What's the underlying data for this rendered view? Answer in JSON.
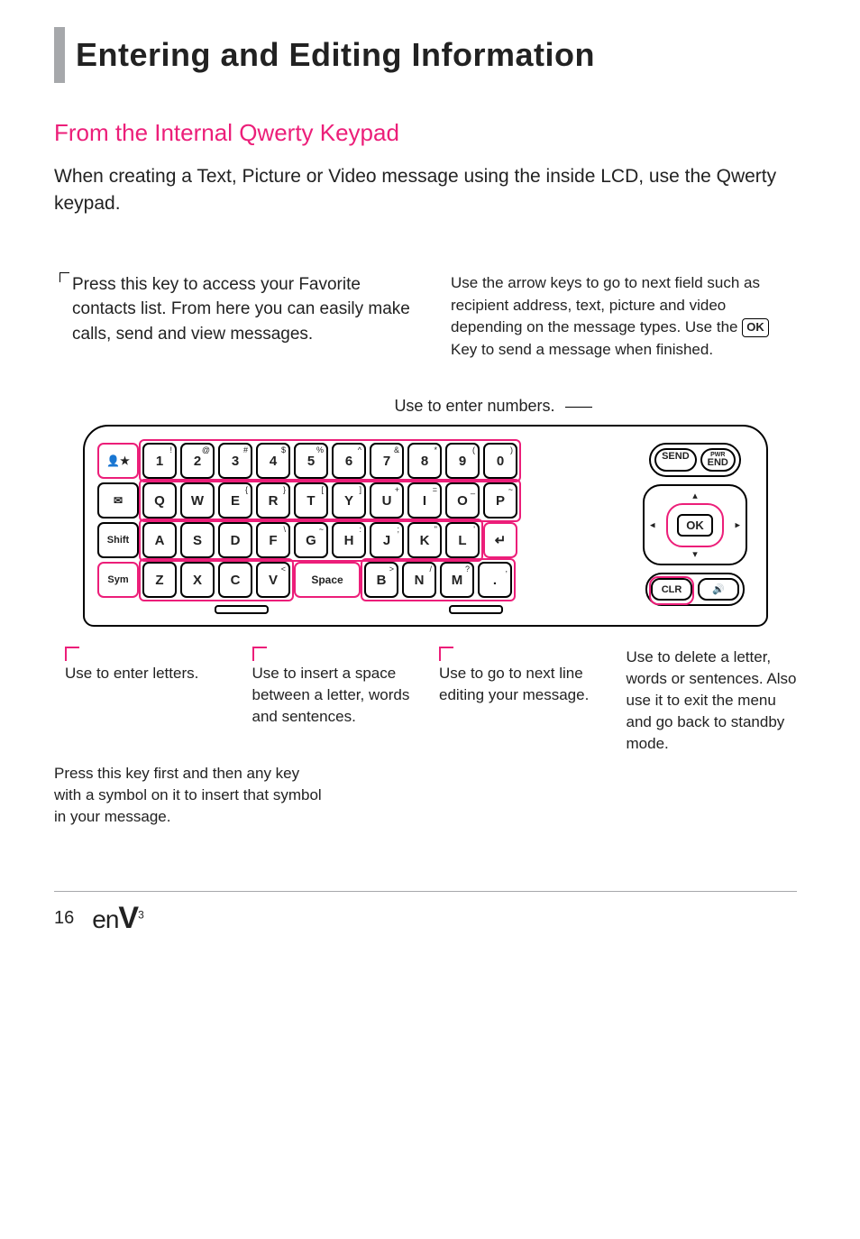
{
  "heading": "Entering and Editing Information",
  "subheading": "From the Internal Qwerty Keypad",
  "intro": "When creating a Text, Picture or Video message using the inside LCD, use the Qwerty keypad.",
  "callout_favorites": "Press this key to access your Favorite contacts list. From here you can easily make calls, send and view messages.",
  "callout_arrows_pre": "Use the arrow keys to go to next field such as recipient address, text, picture and video depending on the message types. Use the ",
  "ok_label": "OK",
  "callout_arrows_post": " Key to send a message when finished.",
  "callout_numbers": "Use to enter numbers.",
  "row1": [
    {
      "m": "1",
      "s": "!"
    },
    {
      "m": "2",
      "s": "@"
    },
    {
      "m": "3",
      "s": "#"
    },
    {
      "m": "4",
      "s": "$"
    },
    {
      "m": "5",
      "s": "%"
    },
    {
      "m": "6",
      "s": "^"
    },
    {
      "m": "7",
      "s": "&"
    },
    {
      "m": "8",
      "s": "*"
    },
    {
      "m": "9",
      "s": "("
    },
    {
      "m": "0",
      "s": ")"
    }
  ],
  "row2": [
    {
      "m": "Q",
      "s": ""
    },
    {
      "m": "W",
      "s": ""
    },
    {
      "m": "E",
      "s": "{"
    },
    {
      "m": "R",
      "s": "}"
    },
    {
      "m": "T",
      "s": "["
    },
    {
      "m": "Y",
      "s": "]"
    },
    {
      "m": "U",
      "s": "+"
    },
    {
      "m": "I",
      "s": "="
    },
    {
      "m": "O",
      "s": "_"
    },
    {
      "m": "P",
      "s": "~"
    }
  ],
  "row3": [
    {
      "m": "A",
      "s": ""
    },
    {
      "m": "S",
      "s": ""
    },
    {
      "m": "D",
      "s": ""
    },
    {
      "m": "F",
      "s": "\\"
    },
    {
      "m": "G",
      "s": "~"
    },
    {
      "m": "H",
      "s": ":"
    },
    {
      "m": "J",
      "s": ";"
    },
    {
      "m": "K",
      "s": "\""
    },
    {
      "m": "L",
      "s": "'"
    }
  ],
  "row4": [
    {
      "m": "Z",
      "s": ""
    },
    {
      "m": "X",
      "s": ""
    },
    {
      "m": "C",
      "s": ""
    },
    {
      "m": "V",
      "s": "<"
    }
  ],
  "row4b": [
    {
      "m": "B",
      "s": ">"
    },
    {
      "m": "N",
      "s": "/"
    },
    {
      "m": "M",
      "s": "?"
    },
    {
      "m": ".",
      "s": ","
    }
  ],
  "fav_key": "★",
  "msg_key": "✉",
  "shift_key": "Shift",
  "sym_key": "Sym",
  "space_key": "Space",
  "enter_key": "↵",
  "send_key": "SEND",
  "end_key_top": "PWR",
  "end_key_bot": "END",
  "clr_key": "CLR",
  "spk_key": "🔊",
  "callout_letters": "Use to enter letters.",
  "callout_space": "Use to insert a space between a letter, words and sentences.",
  "callout_nextline": "Use to go to next line editing your message.",
  "callout_clr": "Use to delete a letter, words or sentences. Also use it to exit the menu and go back to standby mode.",
  "callout_sym": "Press this key first and then any key with a symbol on it to insert that symbol in your message.",
  "page_number": "16",
  "logo_pre": "en",
  "logo_v": "V",
  "logo_suf": "3"
}
